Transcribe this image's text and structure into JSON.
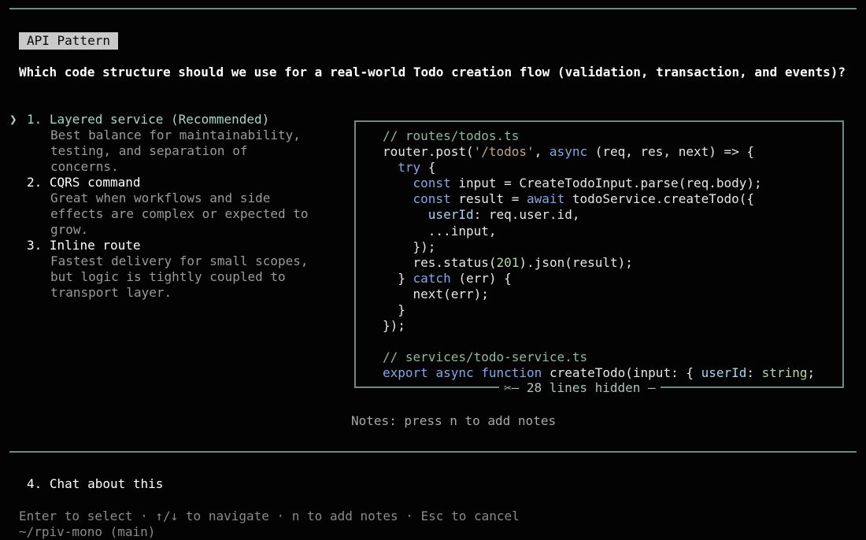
{
  "header": {
    "tag": "API Pattern"
  },
  "question": "Which code structure should we use for a real-world Todo creation flow (validation, transaction, and events)?",
  "options": [
    {
      "number": "1.",
      "title": "Layered service (Recommended)",
      "desc": [
        "Best balance for maintainability,",
        "testing, and separation of",
        "concerns."
      ],
      "selected": true
    },
    {
      "number": "2.",
      "title": "CQRS command",
      "desc": [
        "Great when workflows and side",
        "effects are complex or expected to",
        "grow."
      ],
      "selected": false
    },
    {
      "number": "3.",
      "title": "Inline route",
      "desc": [
        "Fastest delivery for small scopes,",
        "but logic is tightly coupled to",
        "transport layer."
      ],
      "selected": false
    }
  ],
  "pointer": "❯",
  "code_preview": {
    "lines": [
      [
        {
          "t": "// routes/todos.ts",
          "c": "comment"
        }
      ],
      [
        {
          "t": "router.post(",
          "c": ""
        },
        {
          "t": "'/todos'",
          "c": "str"
        },
        {
          "t": ", ",
          "c": ""
        },
        {
          "t": "async",
          "c": "kw"
        },
        {
          "t": " (req, res, next) => {",
          "c": ""
        }
      ],
      [
        {
          "t": "  ",
          "c": ""
        },
        {
          "t": "try",
          "c": "kw"
        },
        {
          "t": " {",
          "c": ""
        }
      ],
      [
        {
          "t": "    ",
          "c": ""
        },
        {
          "t": "const",
          "c": "kw"
        },
        {
          "t": " input = CreateTodoInput.parse(req.body);",
          "c": ""
        }
      ],
      [
        {
          "t": "    ",
          "c": ""
        },
        {
          "t": "const",
          "c": "kw"
        },
        {
          "t": " result = ",
          "c": ""
        },
        {
          "t": "await",
          "c": "kw"
        },
        {
          "t": " todoService.createTodo({",
          "c": ""
        }
      ],
      [
        {
          "t": "      ",
          "c": ""
        },
        {
          "t": "userId",
          "c": "prop"
        },
        {
          "t": ": req.user.id,",
          "c": ""
        }
      ],
      [
        {
          "t": "      ...input,",
          "c": ""
        }
      ],
      [
        {
          "t": "    });",
          "c": ""
        }
      ],
      [
        {
          "t": "    res.status(",
          "c": ""
        },
        {
          "t": "201",
          "c": "num"
        },
        {
          "t": ").json(result);",
          "c": ""
        }
      ],
      [
        {
          "t": "  } ",
          "c": ""
        },
        {
          "t": "catch",
          "c": "kw"
        },
        {
          "t": " (err) {",
          "c": ""
        }
      ],
      [
        {
          "t": "    next(err);",
          "c": ""
        }
      ],
      [
        {
          "t": "  }",
          "c": ""
        }
      ],
      [
        {
          "t": "});",
          "c": ""
        }
      ],
      [
        {
          "t": "",
          "c": ""
        }
      ],
      [
        {
          "t": "// services/todo-service.ts",
          "c": "comment"
        }
      ],
      [
        {
          "t": "export",
          "c": "kw"
        },
        {
          "t": " ",
          "c": ""
        },
        {
          "t": "async",
          "c": "kw"
        },
        {
          "t": " ",
          "c": ""
        },
        {
          "t": "function",
          "c": "kw"
        },
        {
          "t": " createTodo(input: { ",
          "c": ""
        },
        {
          "t": "userId",
          "c": "prop"
        },
        {
          "t": ": ",
          "c": ""
        },
        {
          "t": "string",
          "c": "num"
        },
        {
          "t": ";",
          "c": ""
        }
      ]
    ],
    "hidden_label": "✂— 28 lines hidden —"
  },
  "notes_hint": "Notes: press n to add notes",
  "chat_option": "4. Chat about this",
  "help_line": "Enter to select · ↑/↓ to navigate · n to add notes · Esc to cancel",
  "repo_line": "~/rpiv-mono (main)"
}
